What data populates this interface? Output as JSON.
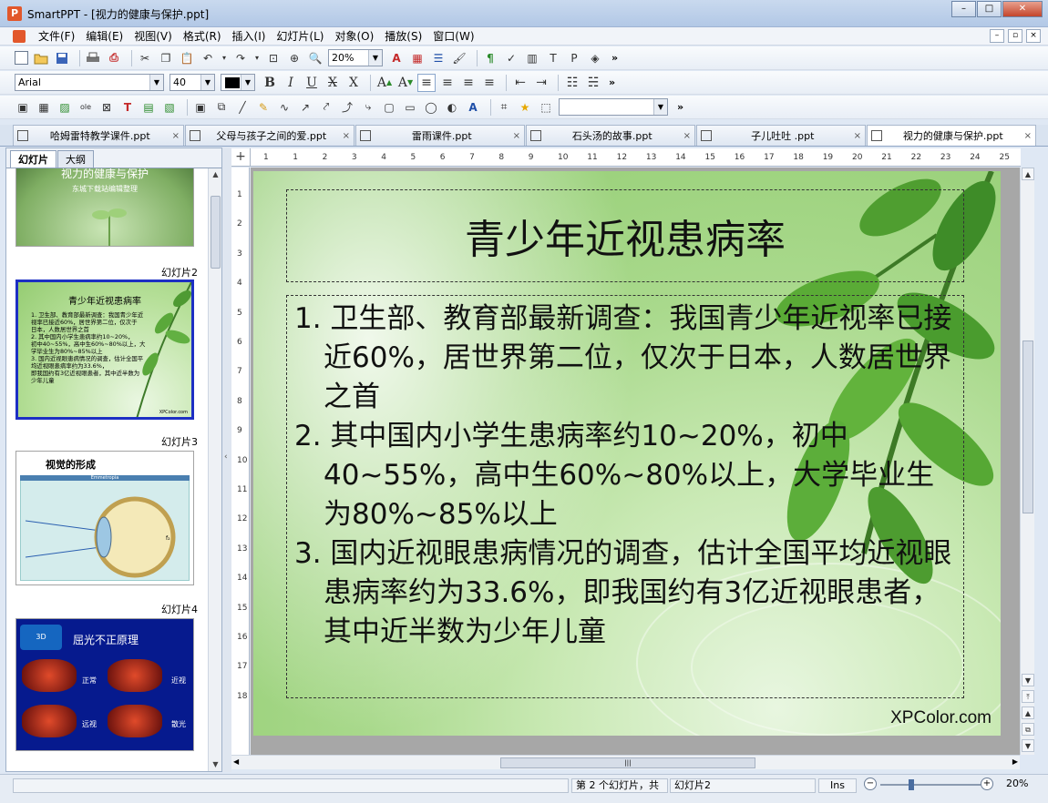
{
  "window": {
    "title": "SmartPPT - [视力的健康与保护.ppt]",
    "min": "–",
    "max": "□",
    "close": "✕"
  },
  "menu": {
    "items": [
      "文件(F)",
      "编辑(E)",
      "视图(V)",
      "格式(R)",
      "插入(I)",
      "幻灯片(L)",
      "对象(O)",
      "播放(S)",
      "窗口(W)"
    ],
    "mdi": [
      "–",
      "▫",
      "×"
    ]
  },
  "toolbar": {
    "zoom_value": "20%",
    "font_name": "Arial",
    "font_size": "40",
    "more": "»"
  },
  "tabs": [
    {
      "label": "哈姆雷特教学课件.ppt",
      "close": "×"
    },
    {
      "label": "父母与孩子之间的爱.ppt",
      "close": "×"
    },
    {
      "label": "雷雨课件.ppt",
      "close": "×"
    },
    {
      "label": "石头汤的故事.ppt",
      "close": "×"
    },
    {
      "label": "子儿吐吐 .ppt",
      "close": "×"
    },
    {
      "label": "视力的健康与保护.ppt",
      "close": "×"
    }
  ],
  "panel": {
    "tab_slides": "幻灯片",
    "tab_outline": "大纲",
    "thumbs": [
      {
        "label": "",
        "title": "视力的健康与保护",
        "subtitle": "东城下载站编辑整理"
      },
      {
        "label": "幻灯片2",
        "title": "青少年近视患病率",
        "lines": [
          "1. 卫生部、教育部最新调查：我国青少年近",
          "视率已接近60%，居世界第二位，仅次于",
          "日本，人数居世界之首",
          "2. 其中国内小学生患病率约10~20%，",
          "初中40~55%，高中生60%~80%以上，大",
          "学毕业生为80%~85%以上",
          "3.   国内近视眼患病情况的调查，估计全国平",
          "均近视眼患病率约为33.6%，",
          "即我国约有3亿近视眼患者，其中近半数为",
          "少年儿童"
        ],
        "wm": "XPColor.com"
      },
      {
        "label": "幻灯片3",
        "title": "视觉的形成",
        "diagram_label": "Emmetropia",
        "f_label": "f₂"
      },
      {
        "label": "幻灯片4",
        "title": "屈光不正原理",
        "badge": "3D",
        "items": [
          "正常",
          "近视",
          "远视",
          "散光"
        ]
      }
    ]
  },
  "rulers": {
    "h": [
      "1",
      "1",
      "2",
      "3",
      "4",
      "5",
      "6",
      "7",
      "8",
      "9",
      "10",
      "11",
      "12",
      "13",
      "14",
      "15",
      "16",
      "17",
      "18",
      "19",
      "20",
      "21",
      "22",
      "23",
      "24",
      "25"
    ],
    "v": [
      "1",
      "2",
      "3",
      "4",
      "5",
      "6",
      "7",
      "8",
      "9",
      "10",
      "11",
      "12",
      "13",
      "14",
      "15",
      "16",
      "17",
      "18"
    ]
  },
  "slide": {
    "title": "青少年近视患病率",
    "paragraphs": [
      "1. 卫生部、教育部最新调查：我国青少年近视率已接近60%，居世界第二位，仅次于日本，人数居世界之首",
      "2. 其中国内小学生患病率约10~20%，初中40~55%，高中生60%~80%以上，大学毕业生为80%~85%以上",
      "3.   国内近视眼患病情况的调查，估计全国平均近视眼患病率约为33.6%，即我国约有3亿近视眼患者，其中近半数为少年儿童"
    ],
    "watermark": "XPColor.com"
  },
  "status": {
    "slide_position": "第 2 个幻灯片，共",
    "slide_name": "幻灯片2",
    "mode": "Ins",
    "zoom": "20%",
    "zoom_fraction": 0.3
  }
}
